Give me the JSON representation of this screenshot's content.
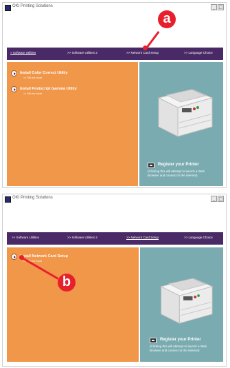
{
  "window": {
    "title": "OKI Printing Solutions",
    "minimize_glyph": "_",
    "close_glyph": "□"
  },
  "screenshot_top": {
    "nav": [
      "» Software Utilities",
      ">> Software Utilities 2",
      ">> Network Card Setup",
      ">> Language Choice"
    ],
    "items": [
      {
        "label": "Install Color Correct Utility",
        "sub": ">> Tell me more"
      },
      {
        "label": "Install Postscript Gamma Utility",
        "sub": ">> Tell me more"
      }
    ],
    "register_title": "Register your Printer",
    "register_note": "(Clicking this will attempt to launch a Web Browser and connect to the internet)",
    "callout": "a"
  },
  "screenshot_bottom": {
    "nav": [
      ">> Software Utilities",
      ">> Software Utilities 2",
      ">> Network Card Setup",
      ">> Language Choice"
    ],
    "items": [
      {
        "label": "Install Network Card Setup",
        "sub": ">> Tell me more"
      }
    ],
    "register_title": "Register your Printer",
    "register_note": "(Clicking this will attempt to launch a Web Browser and connect to the internet)",
    "callout": "b"
  },
  "colors": {
    "nav_bg": "#4a2a66",
    "left_panel": "#f0974a",
    "right_panel": "#7aabb0",
    "callout": "#e8202b"
  }
}
